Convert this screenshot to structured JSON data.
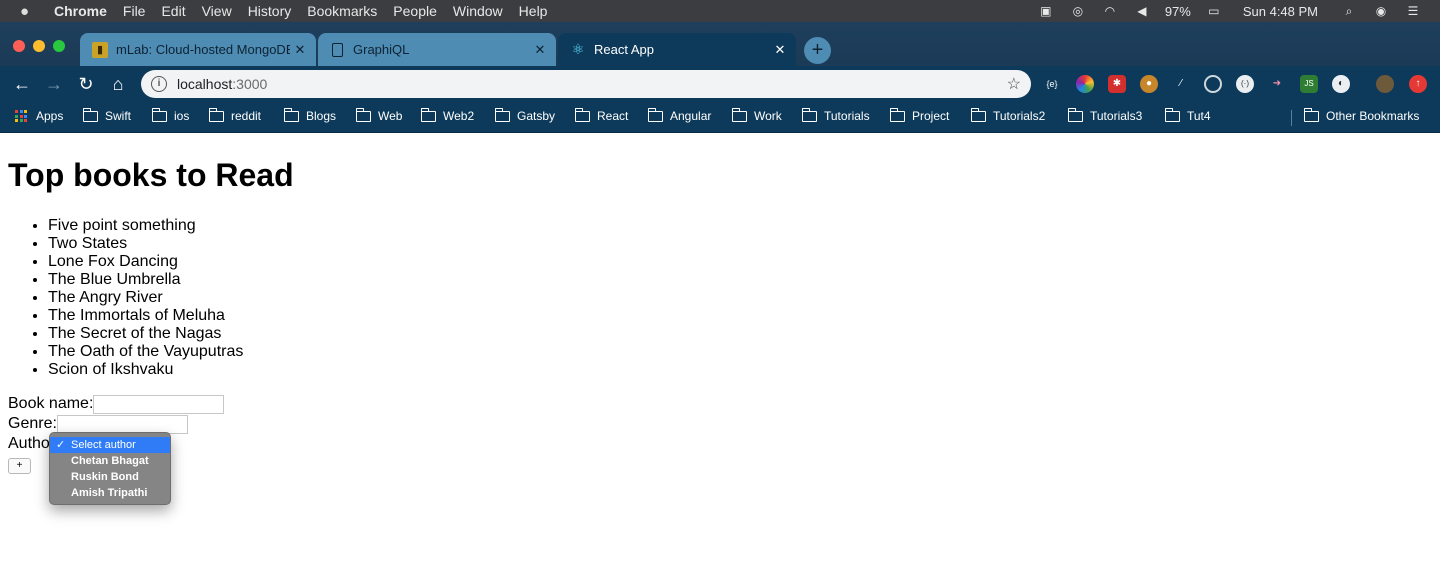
{
  "menubar": {
    "items": [
      "Chrome",
      "File",
      "Edit",
      "View",
      "History",
      "Bookmarks",
      "People",
      "Window",
      "Help"
    ],
    "battery": "97%",
    "clock": "Sun 4:48 PM"
  },
  "tabs": [
    {
      "title": "mLab: Cloud-hosted MongoDB",
      "icon": "mlab-icon",
      "active": false
    },
    {
      "title": "GraphiQL",
      "icon": "page-icon",
      "active": false
    },
    {
      "title": "React App",
      "icon": "react-icon",
      "active": true
    }
  ],
  "toolbar": {
    "url_host": "localhost",
    "url_port": ":3000"
  },
  "bookmarks": {
    "apps_label": "Apps",
    "folders": [
      "Swift",
      "ios",
      "reddit",
      "Blogs",
      "Web",
      "Web2",
      "Gatsby",
      "React",
      "Angular",
      "Work",
      "Tutorials",
      "Project",
      "Tutorials2",
      "Tutorials3",
      "Tut4"
    ],
    "other_label": "Other Bookmarks"
  },
  "page": {
    "heading": "Top books to Read",
    "books": [
      "Five point something",
      "Two States",
      "Lone Fox Dancing",
      "The Blue Umbrella",
      "The Angry River",
      "The Immortals of Meluha",
      "The Secret of the Nagas",
      "The Oath of the Vayuputras",
      "Scion of Ikshvaku"
    ],
    "form": {
      "book_name_label": "Book name:",
      "book_name_value": "",
      "genre_label": "Genre:",
      "genre_value": "",
      "author_label": "Author",
      "submit_label": "+"
    },
    "author_dropdown": {
      "options": [
        "Select author",
        "Chetan Bhagat",
        "Ruskin Bond",
        "Amish Tripathi"
      ],
      "selected_index": 0
    }
  },
  "colors": {
    "menubar": "#3b3d40",
    "tabstrip": "#1e3f5c",
    "inactive_tab": "#4e8cb3",
    "active_chrome": "#0d3a5a",
    "dropdown_highlight": "#2f7cf6"
  }
}
